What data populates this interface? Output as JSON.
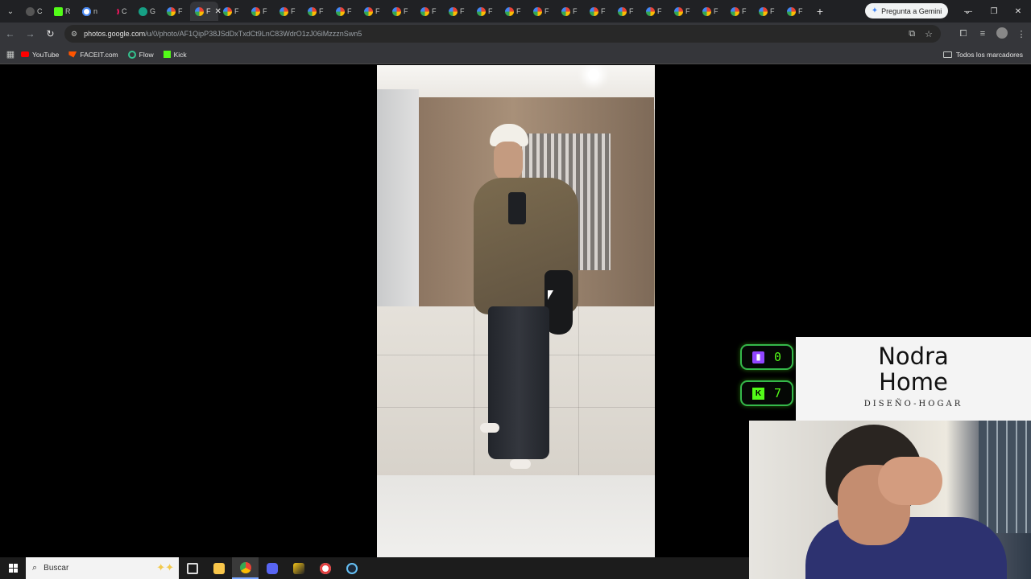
{
  "browser": {
    "tabs": [
      {
        "label": "C",
        "icon": "chevron-icon"
      },
      {
        "label": "R",
        "icon": "kick-favicon-icon"
      },
      {
        "label": "n",
        "icon": "google-favicon-icon"
      },
      {
        "label": "C",
        "icon": "arc-favicon-icon"
      },
      {
        "label": "G",
        "icon": "teal-favicon-icon"
      },
      {
        "label": "F",
        "icon": "google-photos-icon"
      },
      {
        "label": "F",
        "icon": "google-photos-icon",
        "active": true
      },
      {
        "label": "F",
        "icon": "google-photos-icon"
      },
      {
        "label": "F",
        "icon": "google-photos-icon"
      },
      {
        "label": "F",
        "icon": "google-photos-icon"
      },
      {
        "label": "F",
        "icon": "google-photos-icon"
      },
      {
        "label": "F",
        "icon": "google-photos-icon"
      },
      {
        "label": "F",
        "icon": "google-photos-icon"
      },
      {
        "label": "F",
        "icon": "google-photos-icon"
      },
      {
        "label": "F",
        "icon": "google-photos-icon"
      },
      {
        "label": "F",
        "icon": "google-photos-icon"
      },
      {
        "label": "F",
        "icon": "google-photos-icon"
      },
      {
        "label": "F",
        "icon": "google-photos-icon"
      },
      {
        "label": "F",
        "icon": "google-photos-icon"
      },
      {
        "label": "F",
        "icon": "google-photos-icon"
      },
      {
        "label": "F",
        "icon": "google-photos-icon"
      },
      {
        "label": "F",
        "icon": "google-photos-icon"
      },
      {
        "label": "F",
        "icon": "google-photos-icon"
      },
      {
        "label": "F",
        "icon": "google-photos-icon"
      },
      {
        "label": "F",
        "icon": "google-photos-icon"
      },
      {
        "label": "F",
        "icon": "google-photos-icon"
      },
      {
        "label": "F",
        "icon": "google-photos-icon"
      },
      {
        "label": "F",
        "icon": "google-photos-icon"
      }
    ],
    "gemini_label": "Pregunta a Gemini",
    "url_host": "photos.google.com",
    "url_path": "/u/0/photo/AF1QipP38JSdDxTxdCt9LnC83WdrO1zJ06iMzzznSwn5",
    "bookmarks": [
      {
        "label": "YouTube",
        "icon": "youtube-icon"
      },
      {
        "label": "FACEIT.com",
        "icon": "faceit-icon"
      },
      {
        "label": "Flow",
        "icon": "flow-icon"
      },
      {
        "label": "Kick",
        "icon": "kick-icon"
      }
    ],
    "all_bookmarks_label": "Todos los marcadores"
  },
  "overlay": {
    "twitch_count": "0",
    "kick_count": "7",
    "brand_title_line1": "Nodra",
    "brand_title_line2": "Home",
    "brand_subtitle": "DISEÑO-HOGAR",
    "accent_color": "#53fc18",
    "twitch_color": "#9146ff"
  },
  "taskbar": {
    "search_placeholder": "Buscar",
    "apps": [
      "task-view-icon",
      "file-explorer-icon",
      "chrome-icon",
      "discord-icon",
      "app-icon",
      "app-icon",
      "steam-icon"
    ]
  }
}
